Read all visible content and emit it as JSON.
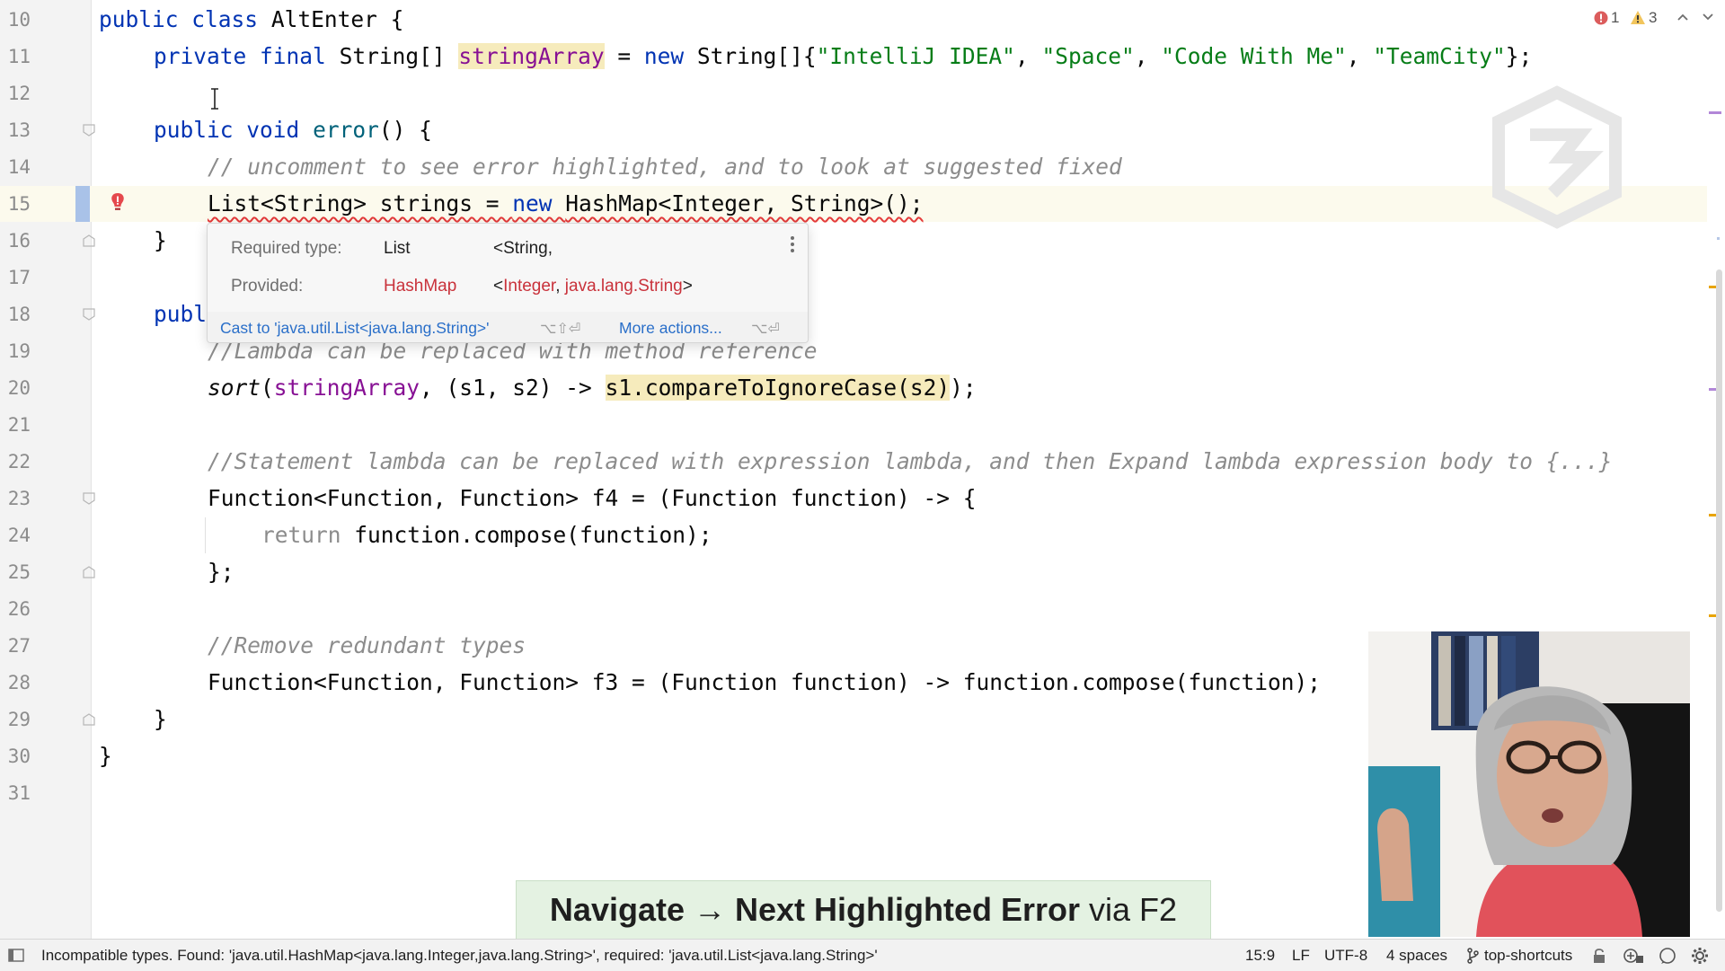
{
  "gutter": {
    "line_numbers": [
      "10",
      "11",
      "12",
      "13",
      "14",
      "15",
      "16",
      "17",
      "18",
      "19",
      "20",
      "21",
      "22",
      "23",
      "24",
      "25",
      "26",
      "27",
      "28",
      "29",
      "30",
      "31"
    ]
  },
  "code": {
    "l10": {
      "kw1": "public",
      "kw2": "class",
      "rest": "AltEnter {"
    },
    "l11": {
      "kw1": "private",
      "kw2": "final",
      "type": "String[]",
      "field": "stringArray",
      "eq": " = ",
      "kw3": "new",
      "ctor": "String[]{",
      "s1": "\"IntelliJ IDEA\"",
      "c1": ", ",
      "s2": "\"Space\"",
      "c2": ", ",
      "s3": "\"Code With Me\"",
      "c3": ", ",
      "s4": "\"TeamCity\"",
      "end": "};"
    },
    "l13": {
      "kw1": "public",
      "kw2": "void",
      "method": "error",
      "rest": "() {"
    },
    "l14": {
      "comment": "// uncomment to see error highlighted, and to look at suggested fixed"
    },
    "l15": {
      "decl": "List<String> strings = ",
      "kw": "new",
      "rest": "HashMap<Integer, String>();"
    },
    "l16": {
      "text": "}"
    },
    "l18": {
      "text": "publ"
    },
    "l19": {
      "comment": "//Lambda can be replaced with method reference"
    },
    "l20": {
      "method": "sort",
      "open": "(",
      "field": "stringArray",
      "mid": ", (s1, s2) -> ",
      "hl": "s1.compareToIgnoreCase(s2)",
      "end": ");"
    },
    "l22": {
      "comment": "//Statement lambda can be replaced with expression lambda, and then Expand lambda expression body to {...}"
    },
    "l23": {
      "text": "Function<Function, Function> f4 = (Function function) -> {"
    },
    "l24": {
      "kw": "return",
      "rest": " function.compose(function);"
    },
    "l25": {
      "text": "};"
    },
    "l27": {
      "comment": "//Remove redundant types"
    },
    "l28": {
      "text": "Function<Function, Function> f3 = (Function function) -> function.compose(function);"
    },
    "l29": {
      "text": "}"
    },
    "l30": {
      "text": "}"
    }
  },
  "inspection": {
    "errors": "1",
    "warnings": "3"
  },
  "popup": {
    "required_label": "Required type:",
    "required_type": "List",
    "required_args": "<String,",
    "provided_label": "Provided:",
    "provided_type": "HashMap",
    "provided_open": "<",
    "provided_arg1": "Integer",
    "provided_comma": ", ",
    "provided_arg2": "java.lang.String",
    "provided_close": ">",
    "cast_action": "Cast to 'java.util.List<java.lang.String>'",
    "cast_shortcut": "⌥⇧⏎",
    "more_actions": "More actions...",
    "more_shortcut": "⌥⏎"
  },
  "statusbar": {
    "message": "Incompatible types. Found: 'java.util.HashMap<java.lang.Integer,java.lang.String>', required: 'java.util.List<java.lang.String>'",
    "position": "15:9",
    "line_sep": "LF",
    "encoding": "UTF-8",
    "indent": "4 spaces",
    "branch": "top-shortcuts"
  },
  "caption": {
    "bold": "Navigate → Next Highlighted Error",
    "normal": " via F2"
  },
  "colors": {
    "keyword": "#0033b3",
    "string": "#067d17",
    "field": "#871094",
    "method": "#00627a",
    "comment": "#8c8c8c",
    "error": "#e43a3a",
    "warning": "#e8a400",
    "caption_bg": "#e4f2e2"
  }
}
